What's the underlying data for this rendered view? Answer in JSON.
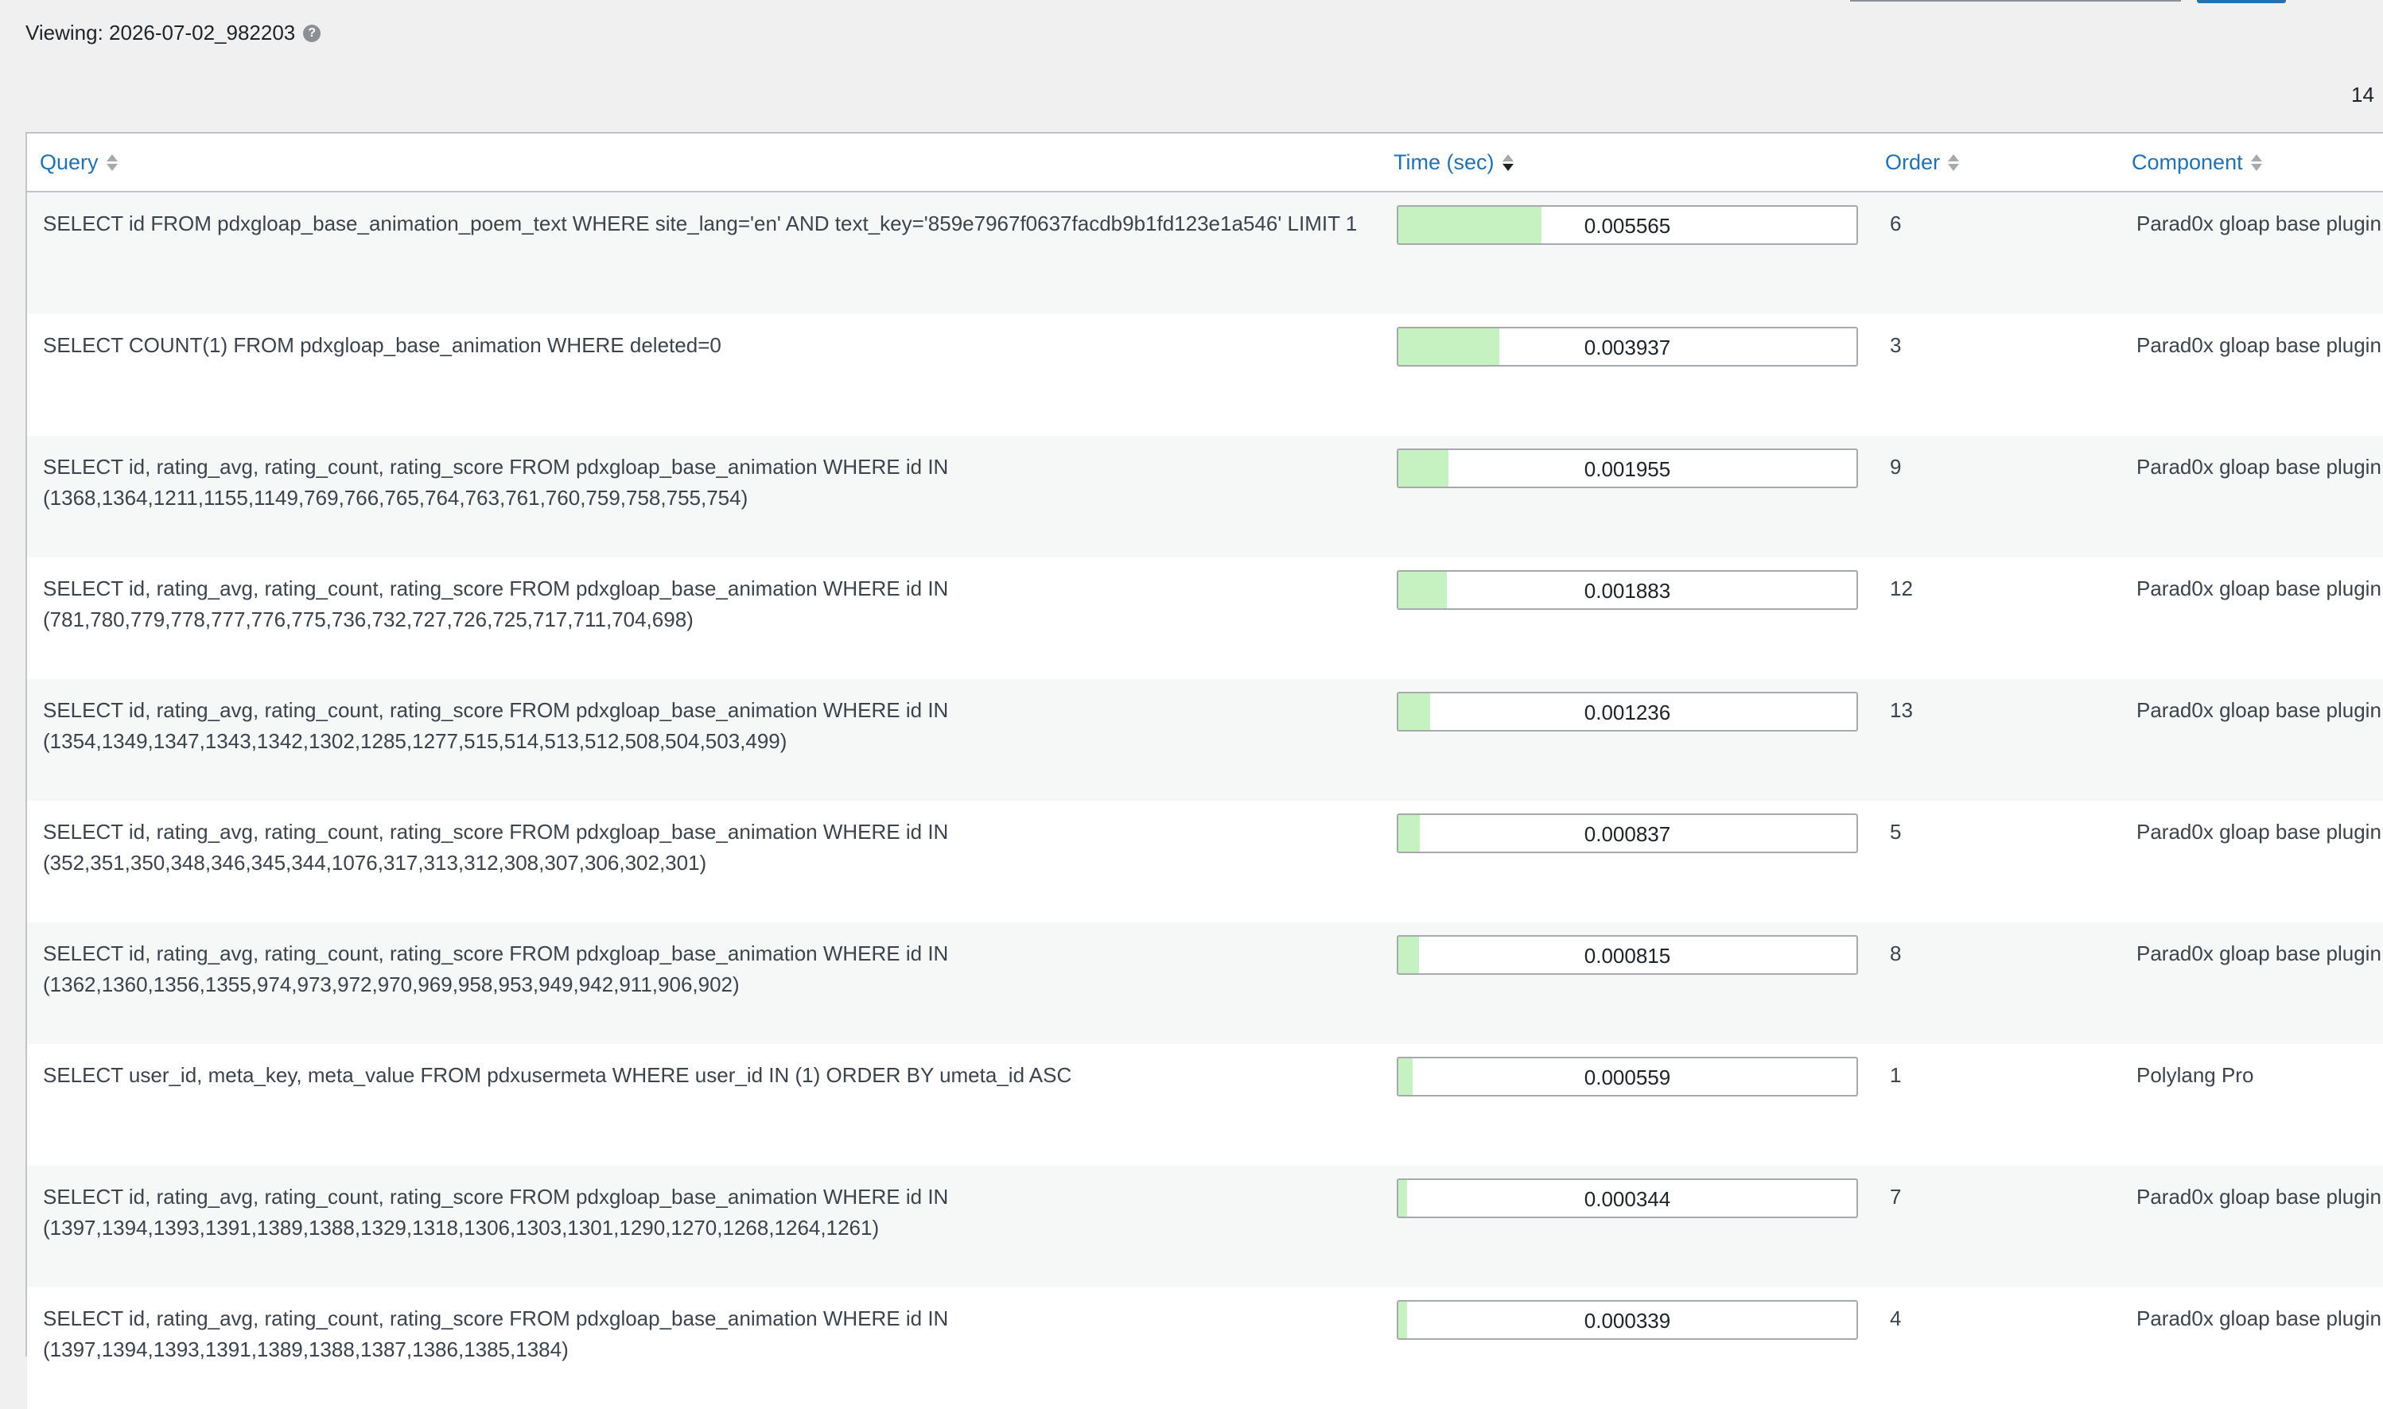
{
  "header": {
    "viewing_label": "Viewing: 2026-07-02_982203",
    "help_icon": "question-circle-icon",
    "count": "14"
  },
  "table": {
    "columns": [
      {
        "label": "Query",
        "sort": "none"
      },
      {
        "label": "Time (sec)",
        "sort": "desc"
      },
      {
        "label": "Order",
        "sort": "none"
      },
      {
        "label": "Component",
        "sort": "none"
      }
    ],
    "max_time": 0.005565,
    "rows": [
      {
        "query": "SELECT id FROM pdxgloap_base_animation_poem_text WHERE site_lang='en' AND text_key='859e7967f0637facdb9b1fd123e1a546' LIMIT 1",
        "time": "0.005565",
        "time_value": 0.005565,
        "order": "6",
        "component": "Parad0x gloap base plugin"
      },
      {
        "query": "SELECT COUNT(1) FROM pdxgloap_base_animation WHERE deleted=0",
        "time": "0.003937",
        "time_value": 0.003937,
        "order": "3",
        "component": "Parad0x gloap base plugin"
      },
      {
        "query": "SELECT id, rating_avg, rating_count, rating_score FROM pdxgloap_base_animation WHERE id IN (1368,1364,1211,1155,1149,769,766,765,764,763,761,760,759,758,755,754)",
        "time": "0.001955",
        "time_value": 0.001955,
        "order": "9",
        "component": "Parad0x gloap base plugin"
      },
      {
        "query": "SELECT id, rating_avg, rating_count, rating_score FROM pdxgloap_base_animation WHERE id IN (781,780,779,778,777,776,775,736,732,727,726,725,717,711,704,698)",
        "time": "0.001883",
        "time_value": 0.001883,
        "order": "12",
        "component": "Parad0x gloap base plugin"
      },
      {
        "query": "SELECT id, rating_avg, rating_count, rating_score FROM pdxgloap_base_animation WHERE id IN (1354,1349,1347,1343,1342,1302,1285,1277,515,514,513,512,508,504,503,499)",
        "time": "0.001236",
        "time_value": 0.001236,
        "order": "13",
        "component": "Parad0x gloap base plugin"
      },
      {
        "query": "SELECT id, rating_avg, rating_count, rating_score FROM pdxgloap_base_animation WHERE id IN (352,351,350,348,346,345,344,1076,317,313,312,308,307,306,302,301)",
        "time": "0.000837",
        "time_value": 0.000837,
        "order": "5",
        "component": "Parad0x gloap base plugin"
      },
      {
        "query": "SELECT id, rating_avg, rating_count, rating_score FROM pdxgloap_base_animation WHERE id IN (1362,1360,1356,1355,974,973,972,970,969,958,953,949,942,911,906,902)",
        "time": "0.000815",
        "time_value": 0.000815,
        "order": "8",
        "component": "Parad0x gloap base plugin"
      },
      {
        "query": "SELECT user_id, meta_key, meta_value FROM pdxusermeta WHERE user_id IN (1) ORDER BY umeta_id ASC",
        "time": "0.000559",
        "time_value": 0.000559,
        "order": "1",
        "component": "Polylang Pro"
      },
      {
        "query": "SELECT id, rating_avg, rating_count, rating_score FROM pdxgloap_base_animation WHERE id IN (1397,1394,1393,1391,1389,1388,1329,1318,1306,1303,1301,1290,1270,1268,1264,1261)",
        "time": "0.000344",
        "time_value": 0.000344,
        "order": "7",
        "component": "Parad0x gloap base plugin"
      },
      {
        "query": "SELECT id, rating_avg, rating_count, rating_score FROM pdxgloap_base_animation WHERE id IN (1397,1394,1393,1391,1389,1388,1387,1386,1385,1384)",
        "time": "0.000339",
        "time_value": 0.000339,
        "order": "4",
        "component": "Parad0x gloap base plugin"
      }
    ]
  },
  "colors": {
    "link": "#2271b1",
    "bar_fill": "#c6f1c0",
    "row_alt": "#f6f7f7"
  }
}
